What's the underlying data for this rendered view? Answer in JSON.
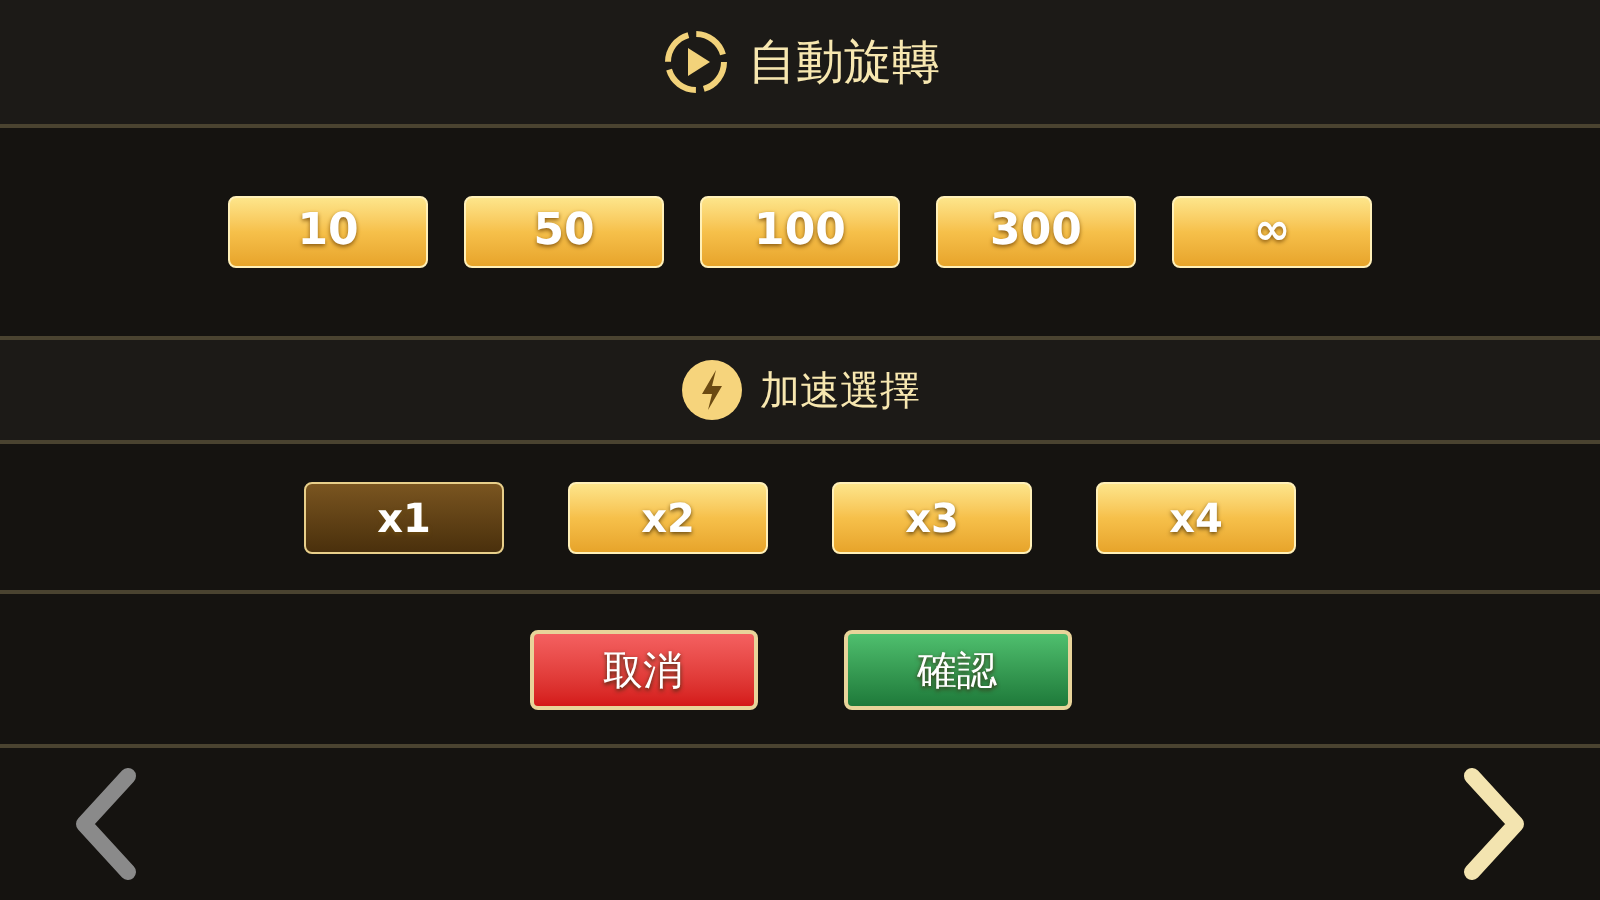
{
  "auto_spin": {
    "title": "自動旋轉",
    "options": [
      {
        "label": "10"
      },
      {
        "label": "50"
      },
      {
        "label": "100"
      },
      {
        "label": "300"
      },
      {
        "label": "∞"
      }
    ]
  },
  "speed": {
    "title": "加速選擇",
    "options": [
      {
        "label": "x1",
        "selected": true
      },
      {
        "label": "x2",
        "selected": false
      },
      {
        "label": "x3",
        "selected": false
      },
      {
        "label": "x4",
        "selected": false
      }
    ]
  },
  "actions": [
    {
      "label": "取消",
      "kind": "cancel"
    },
    {
      "label": "確認",
      "kind": "confirm"
    }
  ],
  "nav": {
    "previous": {
      "disabled": true
    },
    "next": {
      "disabled": false
    }
  }
}
